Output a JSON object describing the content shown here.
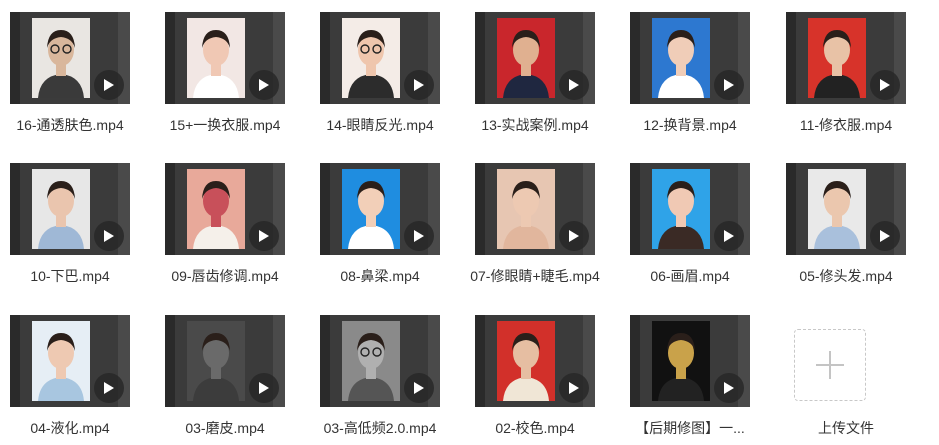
{
  "files": [
    {
      "name": "16-通透肤色.mp4",
      "bg": "#e9e6e2",
      "subject": "#d9b79c",
      "cloth": "#3a3a3a",
      "hasGlasses": true
    },
    {
      "name": "15+一换衣服.mp4",
      "bg": "#f2e7e4",
      "subject": "#f0c8b4",
      "cloth": "#ffffff"
    },
    {
      "name": "14-眼睛反光.mp4",
      "bg": "#f4ece7",
      "subject": "#efc6ad",
      "cloth": "#2c2c2c",
      "hasGlasses": true
    },
    {
      "name": "13-实战案例.mp4",
      "bg": "#c9262c",
      "subject": "#e0b090",
      "cloth": "#1f2740"
    },
    {
      "name": "12-换背景.mp4",
      "bg": "#2d78d0",
      "subject": "#f0cdb8",
      "cloth": "#ffffff"
    },
    {
      "name": "11-修衣服.mp4",
      "bg": "#d7332a",
      "subject": "#e8c2a6",
      "cloth": "#222222"
    },
    {
      "name": "10-下巴.mp4",
      "bg": "#e7e7e7",
      "subject": "#eac5ae",
      "cloth": "#9fb8d6"
    },
    {
      "name": "09-唇齿修调.mp4",
      "bg": "#e8a99a",
      "subject": "#c8505a",
      "cloth": "#f5f0ea"
    },
    {
      "name": "08-鼻梁.mp4",
      "bg": "#1f8de0",
      "subject": "#f2cfb8",
      "cloth": "#ffffff"
    },
    {
      "name": "07-修眼睛+睫毛.mp4",
      "bg": "#e7c6b2",
      "subject": "#edc9b2",
      "cloth": "#e1b69d"
    },
    {
      "name": "06-画眉.mp4",
      "bg": "#2fa3e8",
      "subject": "#f0c9b4",
      "cloth": "#3a2a25"
    },
    {
      "name": "05-修头发.mp4",
      "bg": "#e9e9e9",
      "subject": "#ebc7ae",
      "cloth": "#a9c0dc"
    },
    {
      "name": "04-液化.mp4",
      "bg": "#e6eef5",
      "subject": "#eec9b2",
      "cloth": "#a8c6e0"
    },
    {
      "name": "03-磨皮.mp4",
      "bg": "#4a4a4a",
      "subject": "#6a6a6a",
      "cloth": "#3c3c3c"
    },
    {
      "name": "03-高低频2.0.mp4",
      "bg": "#8a8a8a",
      "subject": "#b0b0b0",
      "cloth": "#555555",
      "hasGlasses": true
    },
    {
      "name": "02-校色.mp4",
      "bg": "#d2302a",
      "subject": "#e6bea2",
      "cloth": "#f0e6d6"
    },
    {
      "name": "【后期修图】一...",
      "bg": "#111111",
      "subject": "#c9a24a",
      "cloth": "#222222"
    }
  ],
  "upload": {
    "label": "上传文件"
  }
}
